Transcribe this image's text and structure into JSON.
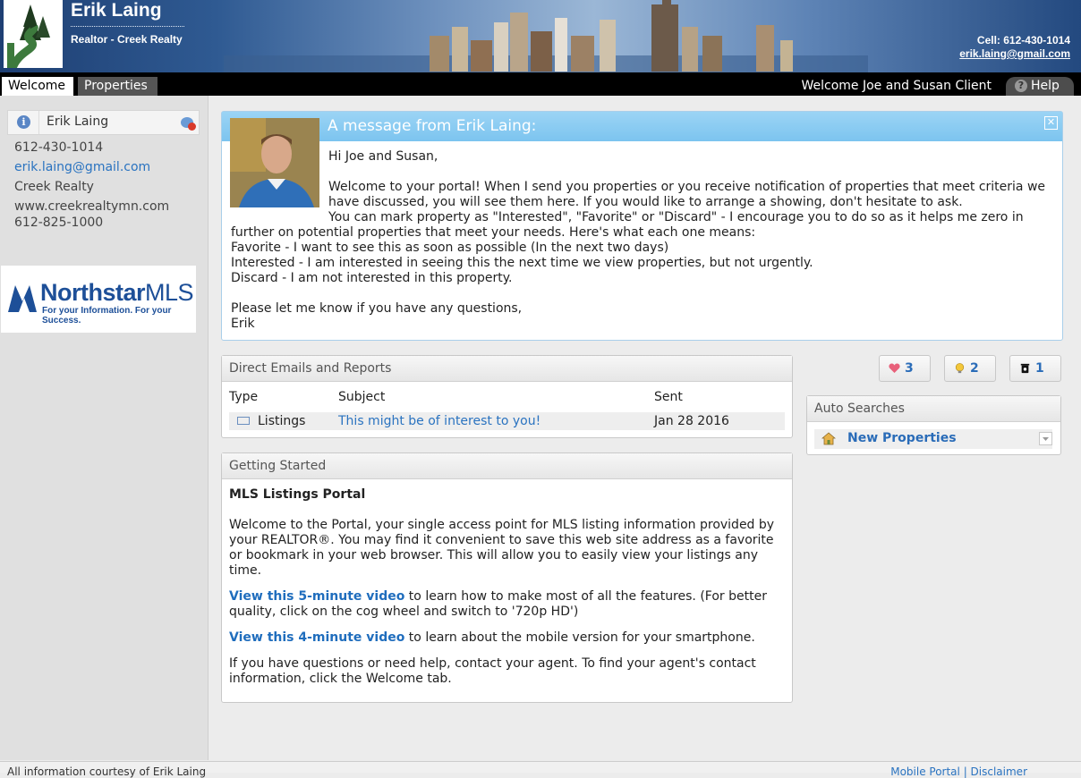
{
  "header": {
    "agent_name": "Erik Laing",
    "agent_title": "Realtor - Creek Realty",
    "cell": "Cell: 612-430-1014",
    "email": "erik.laing@gmail.com"
  },
  "tabs": {
    "welcome": "Welcome",
    "properties": "Properties",
    "welcome_message": "Welcome Joe and Susan Client",
    "help": "Help"
  },
  "sidebar": {
    "contact_name": "Erik Laing",
    "phone": "612-430-1014",
    "email": "erik.laing@gmail.com",
    "company": "Creek Realty",
    "website": "www.creekrealtymn.com",
    "office_phone": "612-825-1000",
    "mls_logo": {
      "brand": "Northstar",
      "brand_suffix": "MLS",
      "tagline": "For your Information. For your Success."
    }
  },
  "message": {
    "title": "A message from Erik Laing:",
    "lines": [
      "Hi Joe and Susan,",
      "",
      "Welcome to your portal! When I send you properties or you receive notification of properties that meet criteria we",
      "have discussed, you will see them here. If you would like to arrange a showing, don't hesitate to ask.",
      "You can mark property as \"Interested\", \"Favorite\" or \"Discard\" - I encourage you to do so as it helps me zero in",
      "further on potential properties that meet your needs. Here's what each one means:",
      "Favorite - I want to see this as soon as possible (In the next two days)",
      "Interested - I am interested in seeing this the next time we view properties, but not urgently.",
      "Discard - I am not interested in this property.",
      "",
      "Please let me know if you have any questions,",
      "Erik"
    ]
  },
  "emails": {
    "title": "Direct Emails and Reports",
    "columns": {
      "type": "Type",
      "subject": "Subject",
      "sent": "Sent"
    },
    "rows": [
      {
        "type": "Listings",
        "subject": "This might be of interest to you!",
        "sent": "Jan 28 2016"
      }
    ]
  },
  "getting_started": {
    "title": "Getting Started",
    "heading": "MLS Listings Portal",
    "intro": "Welcome to the Portal, your single access point for MLS listing information provided by your REALTOR®. You may find it convenient to save this web site address as a favorite or bookmark in your web browser. This will allow you to easily view your listings any time.",
    "video1_link": "View this 5-minute video",
    "video1_text": " to learn how to make most of all the features. (For better quality, click on the cog wheel and switch to '720p HD')",
    "video2_link": "View this 4-minute video",
    "video2_text": " to learn about the mobile version for your smartphone.",
    "help_text": "If you have questions or need help, contact your agent.  To find your agent's contact information, click the Welcome tab."
  },
  "counters": {
    "favorite": "3",
    "interested": "2",
    "discard": "1"
  },
  "auto_searches": {
    "title": "Auto Searches",
    "items": [
      {
        "label": "New Properties"
      }
    ]
  },
  "footer": {
    "text": "All information courtesy of Erik Laing",
    "links": "Mobile Portal | Disclaimer"
  },
  "colors": {
    "link_blue": "#2a73c0",
    "message_header": "#8ccdf2",
    "favorite_heart": "#e8607a",
    "interested_bulb": "#f3c73a"
  }
}
